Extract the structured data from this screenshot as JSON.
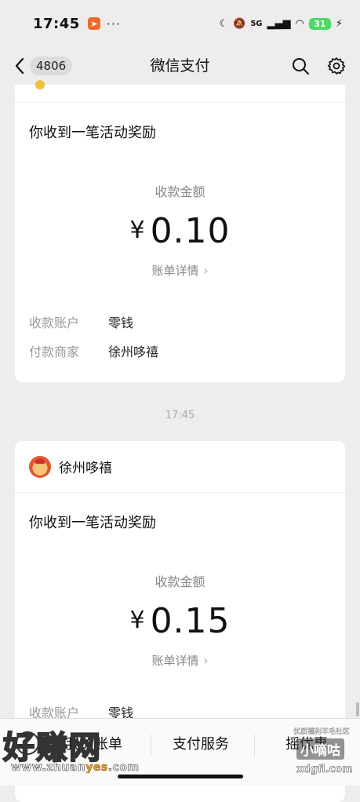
{
  "status_bar": {
    "time": "17:45",
    "app_icon": "send-icon",
    "more": "···",
    "network": "5G",
    "battery": "31"
  },
  "nav": {
    "back_badge": "4806",
    "title": "微信支付",
    "icons": [
      "search-icon",
      "gear-icon"
    ]
  },
  "messages": [
    {
      "headline": "你收到一笔活动奖励",
      "amount_label": "收款金额",
      "currency": "¥",
      "amount": "0.10",
      "detail_link": "账单详情",
      "rows": [
        {
          "key": "收款账户",
          "value": "零钱"
        },
        {
          "key": "付款商家",
          "value": "徐州哆禧"
        }
      ]
    },
    {
      "merchant": "徐州哆禧",
      "headline": "你收到一笔活动奖励",
      "amount_label": "收款金额",
      "currency": "¥",
      "amount": "0.15",
      "detail_link": "账单详情",
      "rows": [
        {
          "key": "收款账户",
          "value": "零钱"
        }
      ]
    }
  ],
  "timestamp": "17:45",
  "bottom_tabs": [
    "我的账单",
    "支付服务",
    "摇优惠"
  ],
  "watermark_left": {
    "big": "好赚网",
    "url_pre": "www.zhuan",
    "url_accent": "yes",
    "url_post": ".com"
  },
  "watermark_right": {
    "top": "优质福利羊毛社区",
    "mid": "小嘀咕",
    "bottom": "xdgfl.com"
  }
}
